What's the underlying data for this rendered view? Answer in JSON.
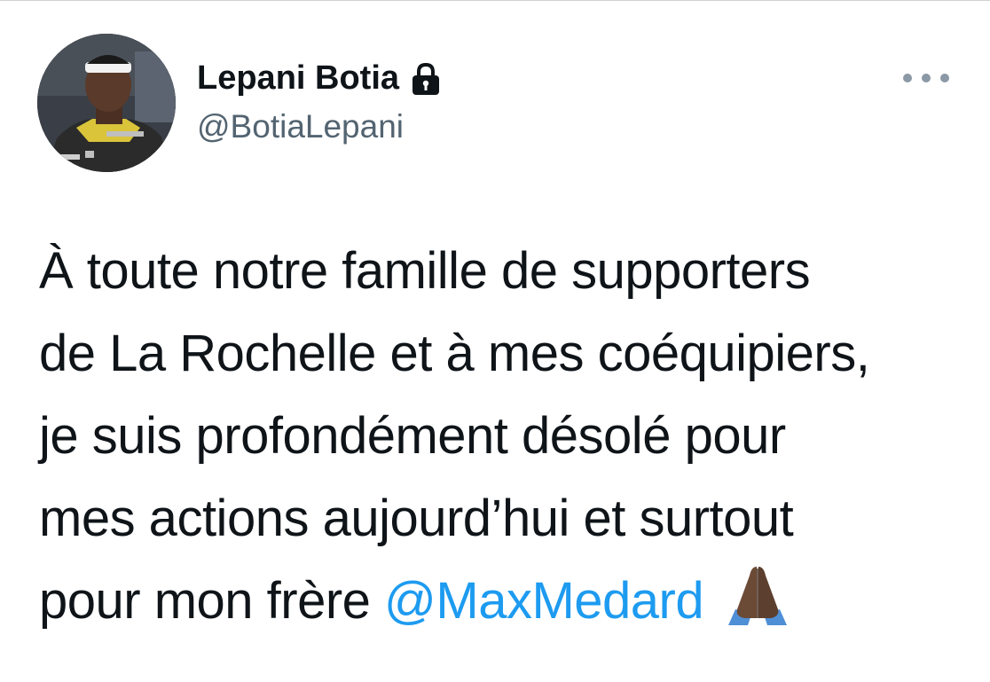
{
  "author": {
    "display_name": "Lepani Botia",
    "handle": "@BotiaLepani"
  },
  "tweet": {
    "lines": [
      "À toute notre famille de supporters",
      "de La Rochelle et à mes coéquipiers,",
      "je suis profondément désolé pour",
      "mes actions aujourd’hui et surtout"
    ],
    "last_line_prefix": "pour mon frère ",
    "mention": "@MaxMedard"
  },
  "icons": {
    "protected": "lock-icon",
    "more": "more-horizontal-icon",
    "emoji": "folded-hands-emoji"
  },
  "colors": {
    "text": "#0f1419",
    "handle": "#536471",
    "mention": "#1d9bf0"
  }
}
